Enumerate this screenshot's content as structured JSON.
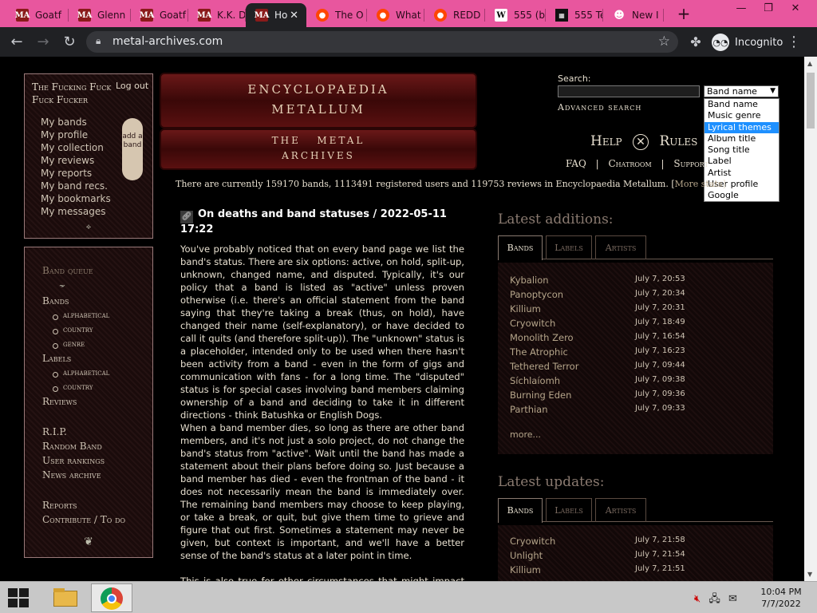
{
  "browser": {
    "tabs": [
      {
        "title": "Goatf",
        "icon": "metal-archives-icon",
        "fav": "MA"
      },
      {
        "title": "Glenn",
        "icon": "metal-archives-icon",
        "fav": "MA"
      },
      {
        "title": "Goatf",
        "icon": "metal-archives-icon",
        "fav": "MA"
      },
      {
        "title": "K.K. D",
        "icon": "metal-archives-icon",
        "fav": "MA"
      },
      {
        "title": "Ho",
        "icon": "metal-archives-icon",
        "fav": "MA",
        "active": true
      },
      {
        "title": "The O",
        "icon": "reddit-icon",
        "fav": "●"
      },
      {
        "title": "What",
        "icon": "reddit-icon",
        "fav": "●"
      },
      {
        "title": "REDD",
        "icon": "reddit-icon",
        "fav": "●"
      },
      {
        "title": "555 (b",
        "icon": "wikipedia-icon",
        "fav": "W"
      },
      {
        "title": "555 Te",
        "icon": "grid-icon",
        "fav": "▦"
      },
      {
        "title": "New I",
        "icon": "incognito-icon",
        "fav": "☻"
      }
    ],
    "url": "metal-archives.com",
    "profile": "Incognito"
  },
  "user": {
    "name": "The Fucking Fuck Fuck Fucker",
    "logout": "Log out",
    "links": [
      "My bands",
      "My profile",
      "My collection",
      "My reviews",
      "My reports",
      "My band recs.",
      "My bookmarks",
      "My messages"
    ],
    "add_band": "add a band"
  },
  "menu": {
    "band_queue": "Band queue",
    "bands": "Bands",
    "bands_sub": [
      "alphabetical",
      "country",
      "genre"
    ],
    "labels": "Labels",
    "labels_sub": [
      "alphabetical",
      "country"
    ],
    "reviews": "Reviews",
    "rip": "R.I.P.",
    "random": "Random Band",
    "rankings": "User rankings",
    "news": "News archive",
    "reports": "Reports",
    "contribute": "Contribute / To do"
  },
  "logo": {
    "line1": "ENCYCLOPAEDIA",
    "line2": "METALLUM",
    "line3": "THE   METAL",
    "line4": "ARCHIVES"
  },
  "search": {
    "label": "Search:",
    "selected": "Band name",
    "options": [
      "Band name",
      "Music genre",
      "Lyrical themes",
      "Album title",
      "Song title",
      "Label",
      "Artist",
      "User profile",
      "Google"
    ],
    "highlighted": "Lyrical themes",
    "advanced": "Advanced search"
  },
  "nav": {
    "help": "Help",
    "rules": "Rules",
    "faq": "FAQ",
    "chatroom": "Chatroom",
    "support": "Support"
  },
  "stats": {
    "text": "There are currently 159170 bands, 1113491 registered users and 119753 reviews in Encyclopaedia Metallum. [",
    "link": "More stats",
    "end": "]"
  },
  "news": {
    "title": "On deaths and band statuses / 2022-05-11 17:22",
    "p1": "You've probably noticed that on every band page we list the band's status. There are six options: active, on hold, split-up, unknown, changed name, and disputed. Typically, it's our policy that a band is listed as \"active\" unless proven otherwise (i.e. there's an official statement from the band saying that they're taking a break (thus, on hold), have changed their name (self-explanatory), or have decided to call it quits (and therefore split-up)). The \"unknown\" status is a placeholder, intended only to be used when there hasn't been activity from a band - even in the form of gigs and communication with fans - for a long time. The \"disputed\" status is for special cases involving band members claiming ownership of a band and deciding to take it in different directions - think Batushka or English Dogs.",
    "p2": "When a band member dies, so long as there are other band members, and it's not just a solo project, do not change the band's status from \"active\". Wait until the band has made a statement about their plans before doing so. Just because a band member has died - even the frontman of the band - it does not necessarily mean the band is immediately over. The remaining band members may choose to keep playing, or take a break, or quit, but give them time to grieve and figure that out first. Sometimes a statement may never be given, but context is important, and we'll have a better sense of the band's status at a later point in time.",
    "p3": "This is also true for other circumstances that might impact the"
  },
  "additions": {
    "title": "Latest additions:",
    "tabs": [
      "Bands",
      "Labels",
      "Artists"
    ],
    "rows": [
      {
        "name": "Kybalion",
        "date": "July 7, 20:53"
      },
      {
        "name": "Panoptycon",
        "date": "July 7, 20:34"
      },
      {
        "name": "Killium",
        "date": "July 7, 20:31"
      },
      {
        "name": "Cryowitch",
        "date": "July 7, 18:49"
      },
      {
        "name": "Monolith Zero",
        "date": "July 7, 16:54"
      },
      {
        "name": "The Atrophic",
        "date": "July 7, 16:23"
      },
      {
        "name": "Tethered Terror",
        "date": "July 7, 09:44"
      },
      {
        "name": "Síchlaíomh",
        "date": "July 7, 09:38"
      },
      {
        "name": "Burning Eden",
        "date": "July 7, 09:36"
      },
      {
        "name": "Parthian",
        "date": "July 7, 09:33"
      }
    ],
    "more": "more..."
  },
  "updates": {
    "title": "Latest updates:",
    "tabs": [
      "Bands",
      "Labels",
      "Artists"
    ],
    "rows": [
      {
        "name": "Cryowitch",
        "date": "July 7, 21:58"
      },
      {
        "name": "Unlight",
        "date": "July 7, 21:54"
      },
      {
        "name": "Killium",
        "date": "July 7, 21:51"
      }
    ]
  },
  "taskbar": {
    "time": "10:04 PM",
    "date": "7/7/2022"
  }
}
